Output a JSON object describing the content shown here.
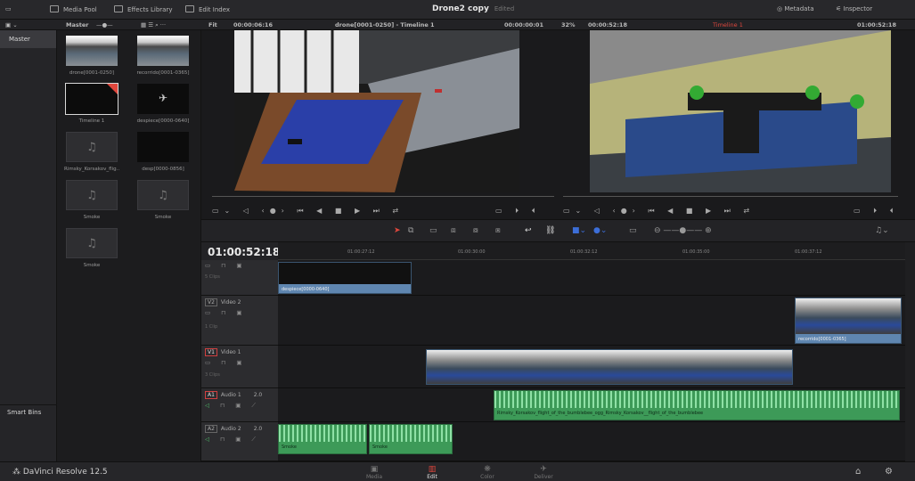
{
  "topbar": {
    "media_pool": "Media Pool",
    "effects_library": "Effects Library",
    "edit_index": "Edit Index",
    "project_name": "Drone2 copy",
    "project_status": "Edited",
    "metadata": "Metadata",
    "inspector": "Inspector"
  },
  "subbar": {
    "bin": "Master",
    "fit": "Fit",
    "source_tc": "00:00:06:16",
    "source_title": "drone[0001-0250] - Timeline 1",
    "source_dur": "00:00:00:01",
    "zoom": "32%",
    "record_dur": "00:00:52:18",
    "timeline_name": "Timeline 1",
    "record_tc": "01:00:52:18"
  },
  "bins": {
    "master": "Master",
    "smart_bins": "Smart Bins"
  },
  "clips": [
    {
      "label": "drone[0001-0250]",
      "kind": "video"
    },
    {
      "label": "recorrido[0001-0365]",
      "kind": "video"
    },
    {
      "label": "Timeline 1",
      "kind": "timeline"
    },
    {
      "label": "despiece[0000-0640]",
      "kind": "video"
    },
    {
      "label": "Rimsky_Korsakov_flig...",
      "kind": "audio"
    },
    {
      "label": "desp[0000-0856]",
      "kind": "video"
    },
    {
      "label": "Smoke",
      "kind": "audio"
    },
    {
      "label": "Smoke",
      "kind": "audio"
    },
    {
      "label": "Smoke",
      "kind": "audio"
    }
  ],
  "timeline": {
    "timecode": "01:00:52:18",
    "ticks": [
      "01:00:27:12",
      "01:00:30:00",
      "01:00:32:12",
      "01:00:35:00",
      "01:00:37:12"
    ]
  },
  "tracks": {
    "v3": {
      "count": "5 Clips"
    },
    "v2": {
      "tag": "V2",
      "name": "Video 2",
      "count": "1 Clip"
    },
    "v1": {
      "tag": "V1",
      "name": "Video 1",
      "count": "3 Clips"
    },
    "a1": {
      "tag": "A1",
      "name": "Audio 1",
      "ch": "2.0"
    },
    "a2": {
      "tag": "A2",
      "name": "Audio 2",
      "ch": "2.0"
    }
  },
  "timeline_clips": {
    "despiece": "despiece[0000-0640]",
    "recorrido": "recorrido[0001-0365]",
    "audio1": "Rimsky_Korsakov_flight_of_the_bumblebee_ogg_Rimsky_Korsakov__flight_of_the_bumblebee",
    "smoke1": "Smoke",
    "smoke2": "Smoke"
  },
  "pages": {
    "media": "Media",
    "edit": "Edit",
    "color": "Color",
    "deliver": "Deliver"
  },
  "brand": "DaVinci Resolve 12.5",
  "colors": {
    "accent_red": "#e0473d",
    "video_clip": "#5f86b0",
    "audio_clip": "#3d9a58"
  }
}
